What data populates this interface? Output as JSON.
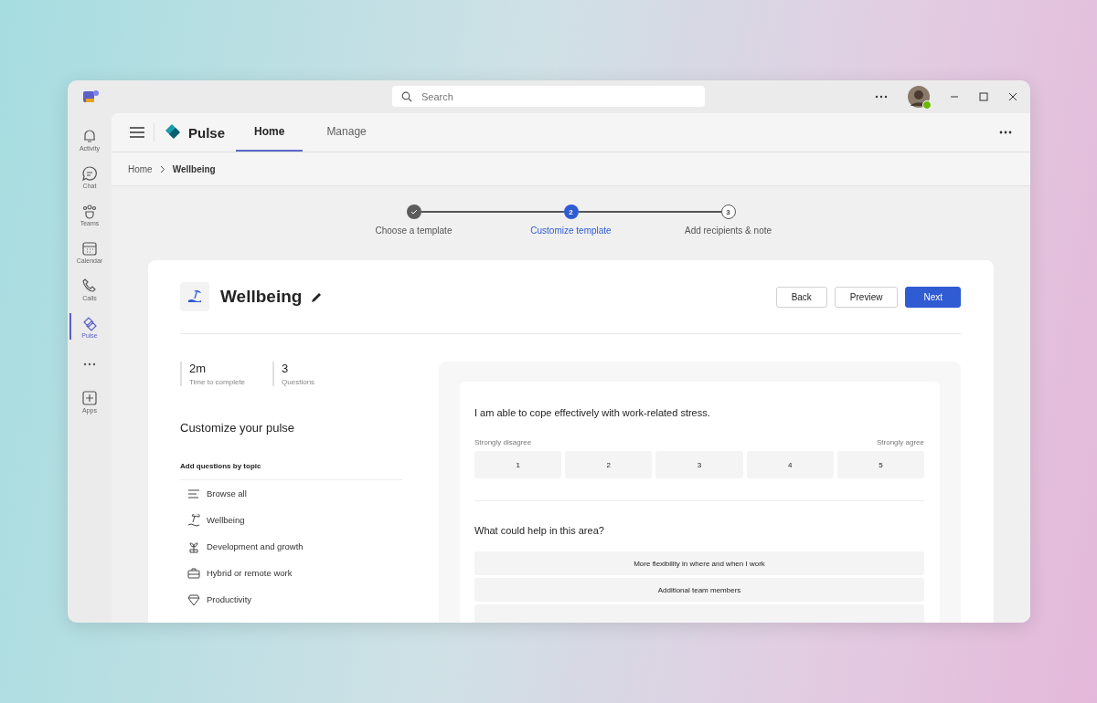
{
  "titlebar": {
    "search": {
      "placeholder": "Search"
    }
  },
  "rail": [
    {
      "kind": "app",
      "label": "Activity",
      "selected": false
    },
    {
      "kind": "app",
      "label": "Chat",
      "selected": false
    },
    {
      "kind": "app",
      "label": "Teams",
      "selected": false
    },
    {
      "kind": "app",
      "label": "Calendar",
      "selected": false
    },
    {
      "kind": "app",
      "label": "Calls",
      "selected": false
    },
    {
      "kind": "app",
      "label": "Pulse",
      "selected": true
    },
    {
      "kind": "more",
      "selected": false
    },
    {
      "kind": "app",
      "label": "Apps",
      "selected": false
    }
  ],
  "app": {
    "name": "Pulse",
    "tabs": [
      {
        "label": "Home",
        "selected": true
      },
      {
        "label": "Manage",
        "selected": false
      }
    ]
  },
  "breadcrumb": [
    "Home",
    "Wellbeing"
  ],
  "steps": [
    {
      "label": "Choose a template",
      "completed": true,
      "selected": false
    },
    {
      "number": "2",
      "label": "Customize template",
      "completed": false,
      "selected": true
    },
    {
      "number": "3",
      "label": "Add recipients & note",
      "completed": false,
      "selected": false
    }
  ],
  "survey": {
    "title": "Wellbeing",
    "buttons": [
      {
        "label": "Back",
        "primary": false
      },
      {
        "label": "Preview",
        "primary": false
      },
      {
        "label": "Next",
        "primary": true
      }
    ],
    "stats": [
      {
        "value": "2m",
        "label": "Time to complete"
      },
      {
        "value": "3",
        "label": "Questions"
      }
    ],
    "section_title": "Customize your pulse",
    "topics_title": "Add questions by topic",
    "topics": [
      "Browse all",
      "Wellbeing",
      "Development and growth",
      "Hybrid or remote work",
      "Productivity"
    ]
  },
  "preview": {
    "question": "I am able to cope effectively with work-related stress.",
    "scale_low": "Strongly disagree",
    "scale_high": "Strongly agree",
    "scale": [
      "1",
      "2",
      "3",
      "4",
      "5"
    ],
    "followup": "What could help in this area?",
    "options": [
      "More flexibility in where and when I work",
      "Additional team members"
    ]
  }
}
